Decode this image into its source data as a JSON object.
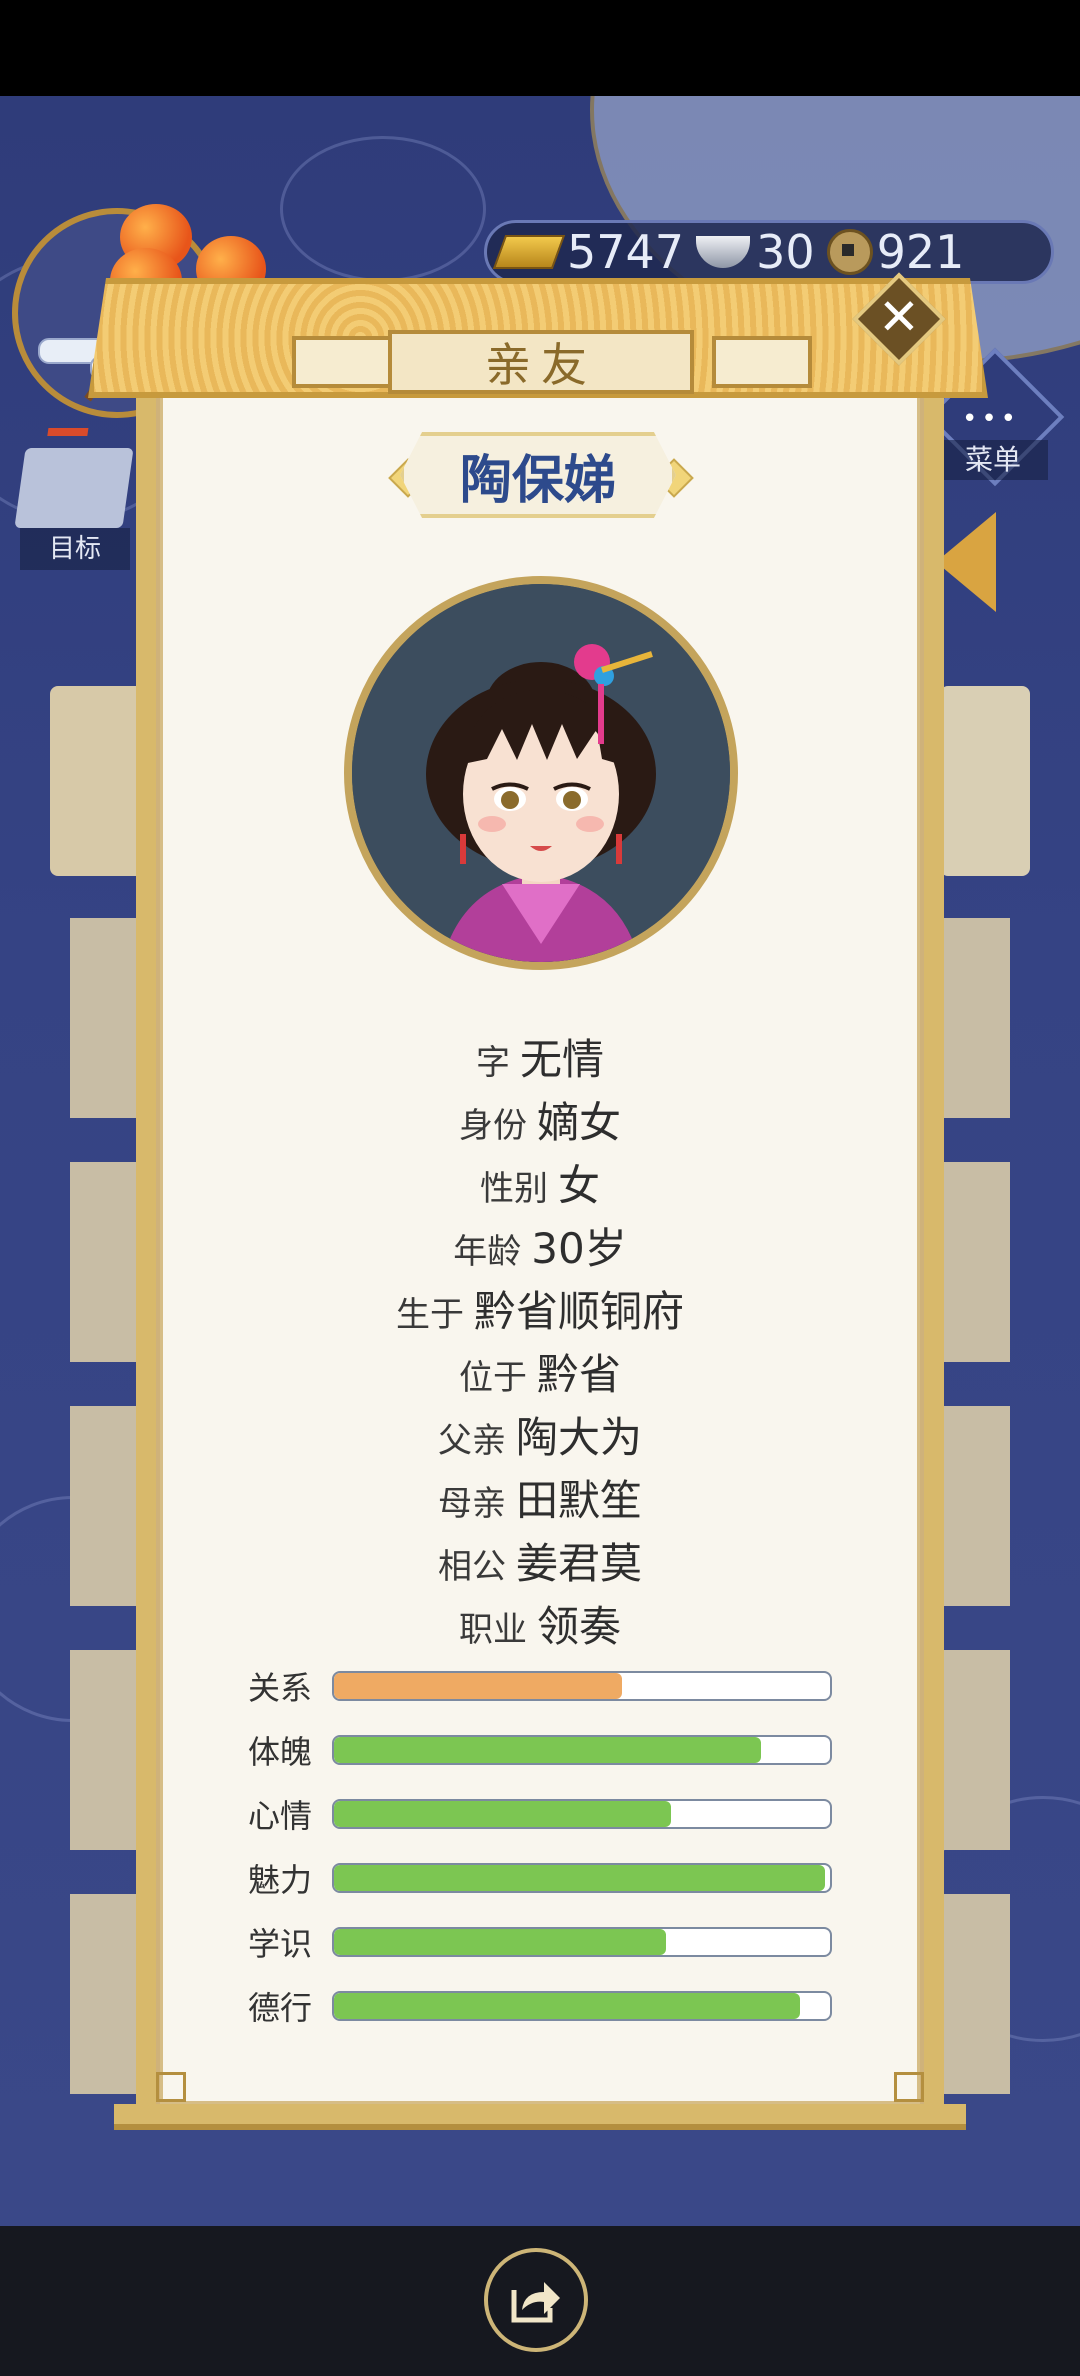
{
  "currency": {
    "gold": "5747",
    "silver": "30",
    "coins": "921"
  },
  "hud": {
    "goal_label": "目标",
    "menu_label": "菜单",
    "menu_dots": "•••"
  },
  "dialog": {
    "title": "亲友",
    "close": "✕",
    "name": "陶保娣",
    "fields": [
      {
        "key": "字",
        "value": "无情"
      },
      {
        "key": "身份",
        "value": "嫡女"
      },
      {
        "key": "性别",
        "value": "女"
      },
      {
        "key": "年龄",
        "value": "30岁"
      },
      {
        "key": "生于",
        "value": "黔省顺铜府"
      },
      {
        "key": "位于",
        "value": "黔省"
      },
      {
        "key": "父亲",
        "value": "陶大为"
      },
      {
        "key": "母亲",
        "value": "田默笙"
      },
      {
        "key": "相公",
        "value": "姜君莫"
      },
      {
        "key": "职业",
        "value": "领奏"
      }
    ],
    "stats": [
      {
        "label": "关系",
        "fraction": 0.58,
        "color": "#efaa63"
      },
      {
        "label": "体魄",
        "fraction": 0.86,
        "color": "#7cc652"
      },
      {
        "label": "心情",
        "fraction": 0.68,
        "color": "#7cc652"
      },
      {
        "label": "魅力",
        "fraction": 0.99,
        "color": "#7cc652"
      },
      {
        "label": "学识",
        "fraction": 0.67,
        "color": "#7cc652"
      },
      {
        "label": "德行",
        "fraction": 0.94,
        "color": "#7cc652"
      }
    ]
  },
  "icons": {
    "share": "share-icon",
    "close": "close-icon",
    "gold": "gold-ingot-icon",
    "silver": "silver-ingot-icon",
    "coin": "copper-coin-icon"
  }
}
